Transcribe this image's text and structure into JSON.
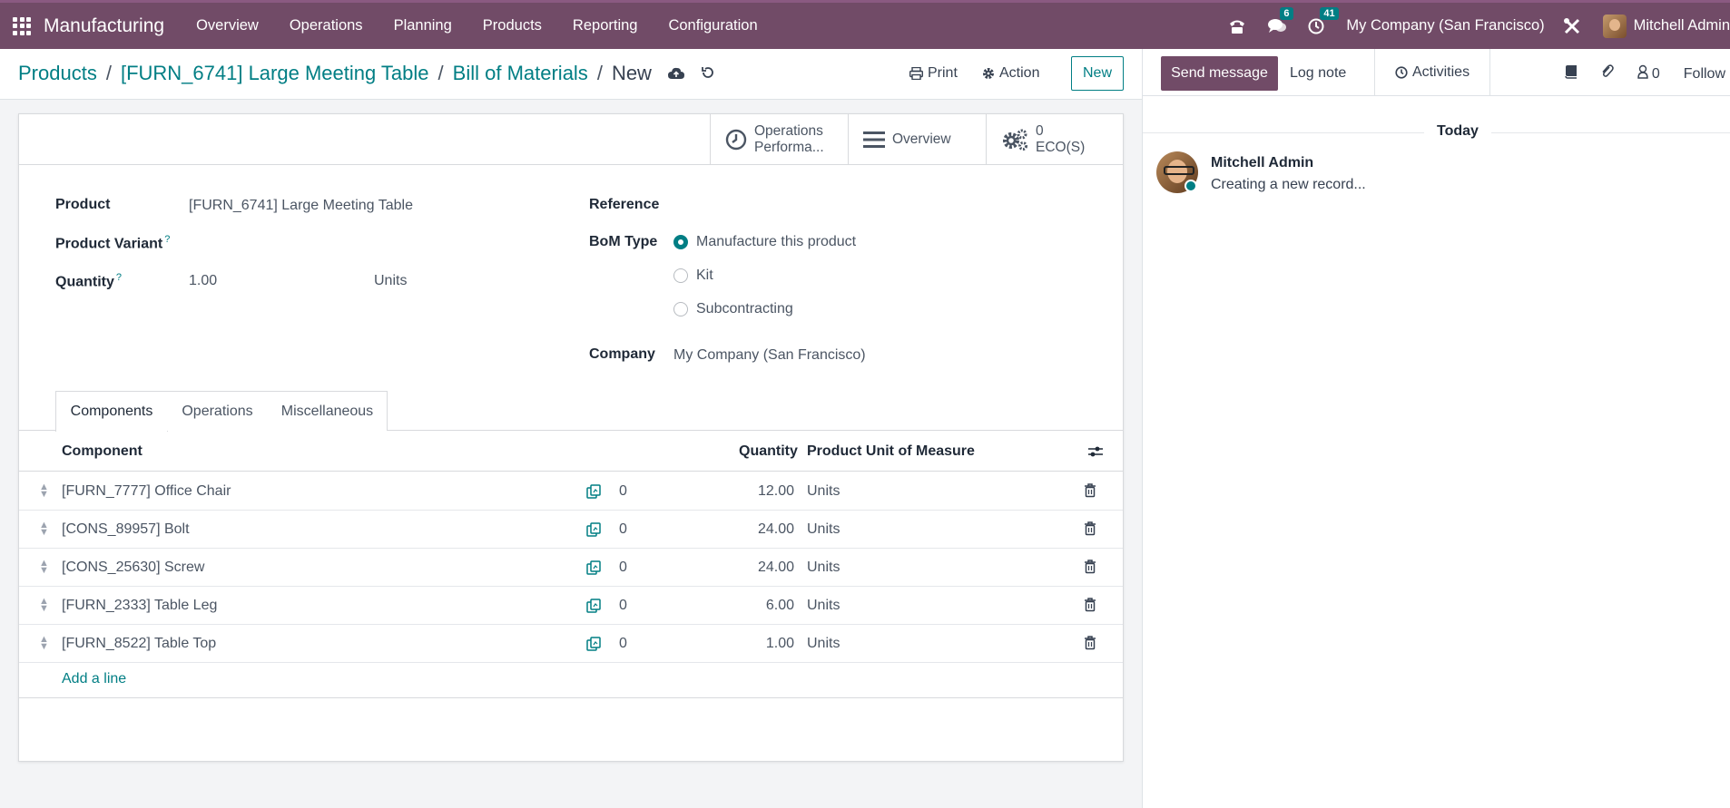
{
  "navbar": {
    "app_title": "Manufacturing",
    "menu": [
      "Overview",
      "Operations",
      "Planning",
      "Products",
      "Reporting",
      "Configuration"
    ],
    "messages_count": "6",
    "activities_count": "41",
    "company": "My Company (San Francisco)",
    "user": "Mitchell Admin"
  },
  "breadcrumb": {
    "items": [
      "Products",
      "[FURN_6741] Large Meeting Table",
      "Bill of Materials"
    ],
    "current": "New"
  },
  "control": {
    "print": "Print",
    "action": "Action",
    "new": "New"
  },
  "stat_buttons": {
    "operations_line1": "Operations",
    "operations_line2": "Performa...",
    "overview": "Overview",
    "eco_count": "0",
    "eco_label": "ECO(S)"
  },
  "form": {
    "product_label": "Product",
    "product_value": "[FURN_6741] Large Meeting Table",
    "variant_label": "Product Variant",
    "quantity_label": "Quantity",
    "quantity_value": "1.00",
    "quantity_uom": "Units",
    "help_mark": "?",
    "reference_label": "Reference",
    "bom_type_label": "BoM Type",
    "bom_types": [
      "Manufacture this product",
      "Kit",
      "Subcontracting"
    ],
    "bom_type_selected": 0,
    "company_label": "Company",
    "company_value": "My Company (San Francisco)"
  },
  "tabs": [
    "Components",
    "Operations",
    "Miscellaneous"
  ],
  "table": {
    "headers": {
      "component": "Component",
      "quantity": "Quantity",
      "uom": "Product Unit of Measure"
    },
    "rows": [
      {
        "component": "[FURN_7777] Office Chair",
        "count": "0",
        "quantity": "12.00",
        "uom": "Units"
      },
      {
        "component": "[CONS_89957] Bolt",
        "count": "0",
        "quantity": "24.00",
        "uom": "Units"
      },
      {
        "component": "[CONS_25630] Screw",
        "count": "0",
        "quantity": "24.00",
        "uom": "Units"
      },
      {
        "component": "[FURN_2333] Table Leg",
        "count": "0",
        "quantity": "6.00",
        "uom": "Units"
      },
      {
        "component": "[FURN_8522] Table Top",
        "count": "0",
        "quantity": "1.00",
        "uom": "Units"
      }
    ],
    "add_line": "Add a line"
  },
  "chatter": {
    "send_message": "Send message",
    "log_note": "Log note",
    "activities": "Activities",
    "followers_count": "0",
    "follow": "Follow",
    "today": "Today",
    "message_author": "Mitchell Admin",
    "message_body": "Creating a new record..."
  },
  "colors": {
    "brand": "#714b67",
    "accent": "#017e84"
  }
}
